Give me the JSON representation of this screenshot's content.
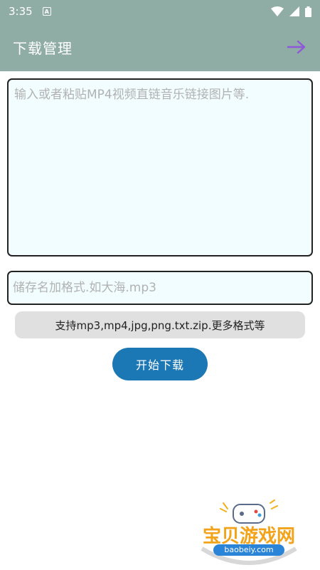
{
  "status_bar": {
    "time": "3:35",
    "notification_glyph": "A",
    "icons": [
      "wifi-icon",
      "signal-icon",
      "battery-icon"
    ]
  },
  "app_bar": {
    "title": "下载管理",
    "action_icon": "arrow-right-icon"
  },
  "form": {
    "url_placeholder": "输入或者粘贴MP4视频直链音乐链接图片等.",
    "url_value": "",
    "name_placeholder": "储存名加格式.如大海.mp3",
    "name_value": "",
    "formats_text": "支持mp3,mp4,jpg,png.txt.zip.更多格式等",
    "download_label": "开始下载"
  },
  "watermark": {
    "brand": "宝贝游戏网",
    "url": "baobeiy.com"
  },
  "colors": {
    "app_bar_bg": "#8fada4",
    "input_bg": "#f1fdfe",
    "button_bg": "#1c78b4",
    "arrow_color": "#8e58d8",
    "formats_bg": "#e0e0e0"
  }
}
